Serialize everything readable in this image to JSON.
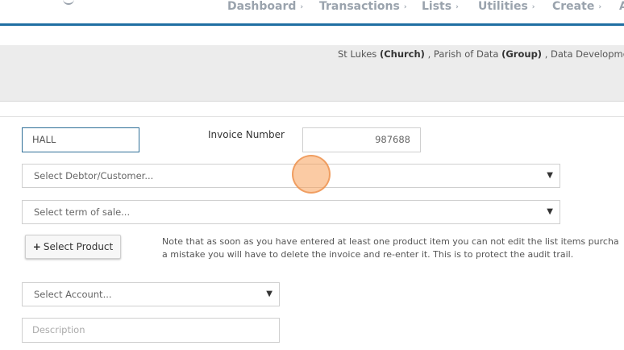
{
  "nav": {
    "items": [
      {
        "label": "Dashboard"
      },
      {
        "label": "Transactions"
      },
      {
        "label": "Lists"
      },
      {
        "label": "Utilities"
      },
      {
        "label": "Create"
      },
      {
        "label": "A"
      }
    ],
    "caret": "›"
  },
  "org": {
    "entity1_name": "St Lukes",
    "entity1_type": "(Church)",
    "sep1": " , ",
    "entity2_name": "Parish of Data",
    "entity2_type": "(Group)",
    "sep2": " , ",
    "entity3_name": "Data Developments"
  },
  "form": {
    "hall_value": "HALL",
    "invoice_label": "Invoice Number",
    "invoice_number": "987688",
    "debtor_placeholder": "Select Debtor/Customer...",
    "term_placeholder": "Select term of sale...",
    "product_button_label": "Select Product",
    "note_line1": "Note that as soon as you have entered at least one product item you can not edit the list items purcha",
    "note_line2": "a mistake you will have to delete the invoice and re-enter it. This is to protect the audit trail.",
    "account_placeholder": "Select Account...",
    "description_placeholder": "Description"
  },
  "colors": {
    "accent": "#1f6fa3",
    "cursor_highlight": "#f7a05a"
  }
}
